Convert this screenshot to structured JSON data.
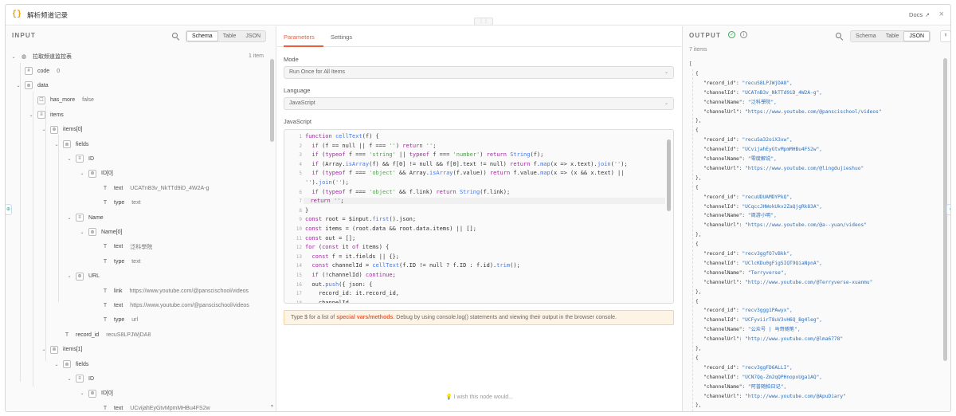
{
  "window": {
    "title": "解析频道记录",
    "docs_label": "Docs"
  },
  "input": {
    "title": "INPUT",
    "tabs": [
      "Schema",
      "Table",
      "JSON"
    ],
    "active_tab": "Schema",
    "root": {
      "label": "拉取频道监控表",
      "count": "1 item"
    },
    "rows": [
      {
        "key": "code",
        "type": "#",
        "value": "0"
      },
      {
        "key": "data",
        "type": "obj"
      },
      {
        "key": "has_more",
        "type": "bool",
        "value": "false"
      },
      {
        "key": "items",
        "type": "arr"
      },
      {
        "key": "items[0]",
        "type": "obj"
      },
      {
        "key": "fields",
        "type": "obj"
      },
      {
        "key": "ID",
        "type": "arr"
      },
      {
        "key": "ID[0]",
        "type": "obj"
      },
      {
        "key": "text",
        "type": "T",
        "value": "UCATnB3v_NkTTd9iD_4W2A-g"
      },
      {
        "key": "type",
        "type": "T",
        "value": "text"
      },
      {
        "key": "Name",
        "type": "arr"
      },
      {
        "key": "Name[0]",
        "type": "obj"
      },
      {
        "key": "text",
        "type": "T",
        "value": "泛科學院"
      },
      {
        "key": "type",
        "type": "T",
        "value": "text"
      },
      {
        "key": "URL",
        "type": "obj"
      },
      {
        "key": "link",
        "type": "T",
        "value": "https://www.youtube.com/@panscischool/videos"
      },
      {
        "key": "text",
        "type": "T",
        "value": "https://www.youtube.com/@panscischool/videos"
      },
      {
        "key": "type",
        "type": "T",
        "value": "url"
      },
      {
        "key": "record_id",
        "type": "T",
        "value": "recuS8LPJWjDA8"
      },
      {
        "key": "items[1]",
        "type": "obj"
      },
      {
        "key": "fields",
        "type": "obj"
      },
      {
        "key": "ID",
        "type": "arr"
      },
      {
        "key": "ID[0]",
        "type": "obj"
      },
      {
        "key": "text",
        "type": "T",
        "value": "UCvijahEyGtvMpmMHBu4FS2w"
      }
    ]
  },
  "params": {
    "tabs": [
      "Parameters",
      "Settings"
    ],
    "mode_label": "Mode",
    "mode_value": "Run Once for All Items",
    "language_label": "Language",
    "language_value": "JavaScript",
    "code_label": "JavaScript",
    "code_lines": [
      "function cellText(f) {",
      "  if (f == null || f === '') return '';",
      "  if (typeof f === 'string' || typeof f === 'number') return String(f);",
      "  if (Array.isArray(f) && f[0] != null && f[0].text != null) return f.map(x => x.text).join('');",
      "  if (typeof f === 'object' && Array.isArray(f.value)) return f.value.map(x => (x && x.text) ||",
      "'').join('');",
      "  if (typeof f === 'object' && f.link) return String(f.link);",
      "  return '';",
      "}",
      "const root = $input.first().json;",
      "const items = (root.data && root.data.items) || [];",
      "const out = [];",
      "for (const it of items) {",
      "  const f = it.fields || {};",
      "  const channelId = cellText(f.ID != null ? f.ID : f.id).trim();",
      "  if (!channelId) continue;",
      "  out.push({ json: {",
      "    record_id: it.record_id,",
      "    channelId,"
    ],
    "line_numbers": [
      "1",
      "2",
      "3",
      "4",
      "5",
      "",
      "6",
      "7",
      "8",
      "9",
      "10",
      "11",
      "12",
      "13",
      "14",
      "15",
      "16",
      "17",
      "18"
    ],
    "hint_prefix": "Type $ for a list of ",
    "hint_link": "special vars/methods",
    "hint_suffix": ". Debug by using console.log() statements and viewing their output in the browser console.",
    "wish": "I wish this node would..."
  },
  "output": {
    "title": "OUTPUT",
    "count": "7 items",
    "tabs": [
      "Schema",
      "Table",
      "JSON"
    ],
    "active_tab": "JSON",
    "records": [
      {
        "record_id": "recuS8LPJWjDA8",
        "channelId": "UCATnB3v_NkTTd9iD_4W2A-g",
        "channelName": "泛科學院",
        "channelUrl": "https://www.youtube.com/@panscischool/videos"
      },
      {
        "record_id": "recuSa32oiX3xw",
        "channelId": "UCvijahEyGtvMpmMHBu4FS2w",
        "channelName": "零度解说",
        "channelUrl": "https://www.youtube.com/@lingdujieshuo"
      },
      {
        "record_id": "recuUDUAMDYPkQ",
        "channelId": "UCqccJHWokUkv2ZaQjgRk83A",
        "channelName": "周游小明",
        "channelUrl": "https://www.youtube.com/@a--yuan/videos"
      },
      {
        "record_id": "recv3ggfO7vBkk",
        "channelId": "UClcKDu0gFigSIQT9QiaNpnA",
        "channelName": "Terryverse",
        "channelUrl": "http://www.youtube.com/@Terryverse-xuanmu"
      },
      {
        "record_id": "recv3ggg1PAwyx",
        "channelId": "UCFyviirT8uV3vH6Q_Bg4leg",
        "channelName": "公众号 | 马哥随笔",
        "channelUrl": "http://www.youtube.com/@lma6778"
      },
      {
        "record_id": "recv3ggFD6ALLI",
        "channelId": "UCN7Qq-Zm2qQPHnopxUga1AQ",
        "channelName": "阿普随拍日记",
        "channelUrl": "http://www.youtube.com/@ApuDiary"
      }
    ]
  }
}
